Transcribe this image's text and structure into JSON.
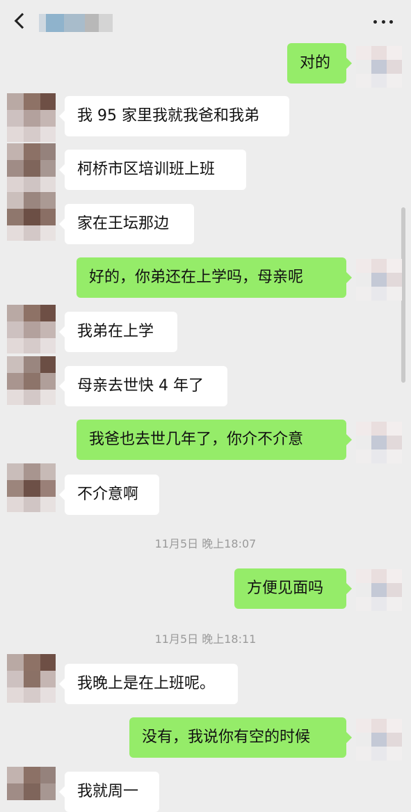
{
  "colors": {
    "background": "#ededed",
    "bubble_left": "#ffffff",
    "bubble_right": "#95ec69"
  },
  "header": {
    "back_icon": "chevron-left-icon",
    "more_icon": "more-dots-icon"
  },
  "timestamps": [
    "11月5日 晚上18:07",
    "11月5日 晚上18:11"
  ],
  "messages": [
    {
      "side": "right",
      "text": "对的"
    },
    {
      "side": "left",
      "text": "我 95 家里我就我爸和我弟"
    },
    {
      "side": "left",
      "text": "柯桥市区培训班上班"
    },
    {
      "side": "left",
      "text": "家在王坛那边"
    },
    {
      "side": "right",
      "text": "好的，你弟还在上学吗，母亲呢"
    },
    {
      "side": "left",
      "text": "我弟在上学"
    },
    {
      "side": "left",
      "text": "母亲去世快 4 年了"
    },
    {
      "side": "right",
      "text": "我爸也去世几年了，你介不介意"
    },
    {
      "side": "left",
      "text": "不介意啊"
    },
    {
      "side": "right",
      "text": "方便见面吗"
    },
    {
      "side": "left",
      "text": "我晚上是在上班呢。"
    },
    {
      "side": "right",
      "text": "没有，我说你有空的时候"
    },
    {
      "side": "left",
      "text": "我就周一"
    }
  ]
}
